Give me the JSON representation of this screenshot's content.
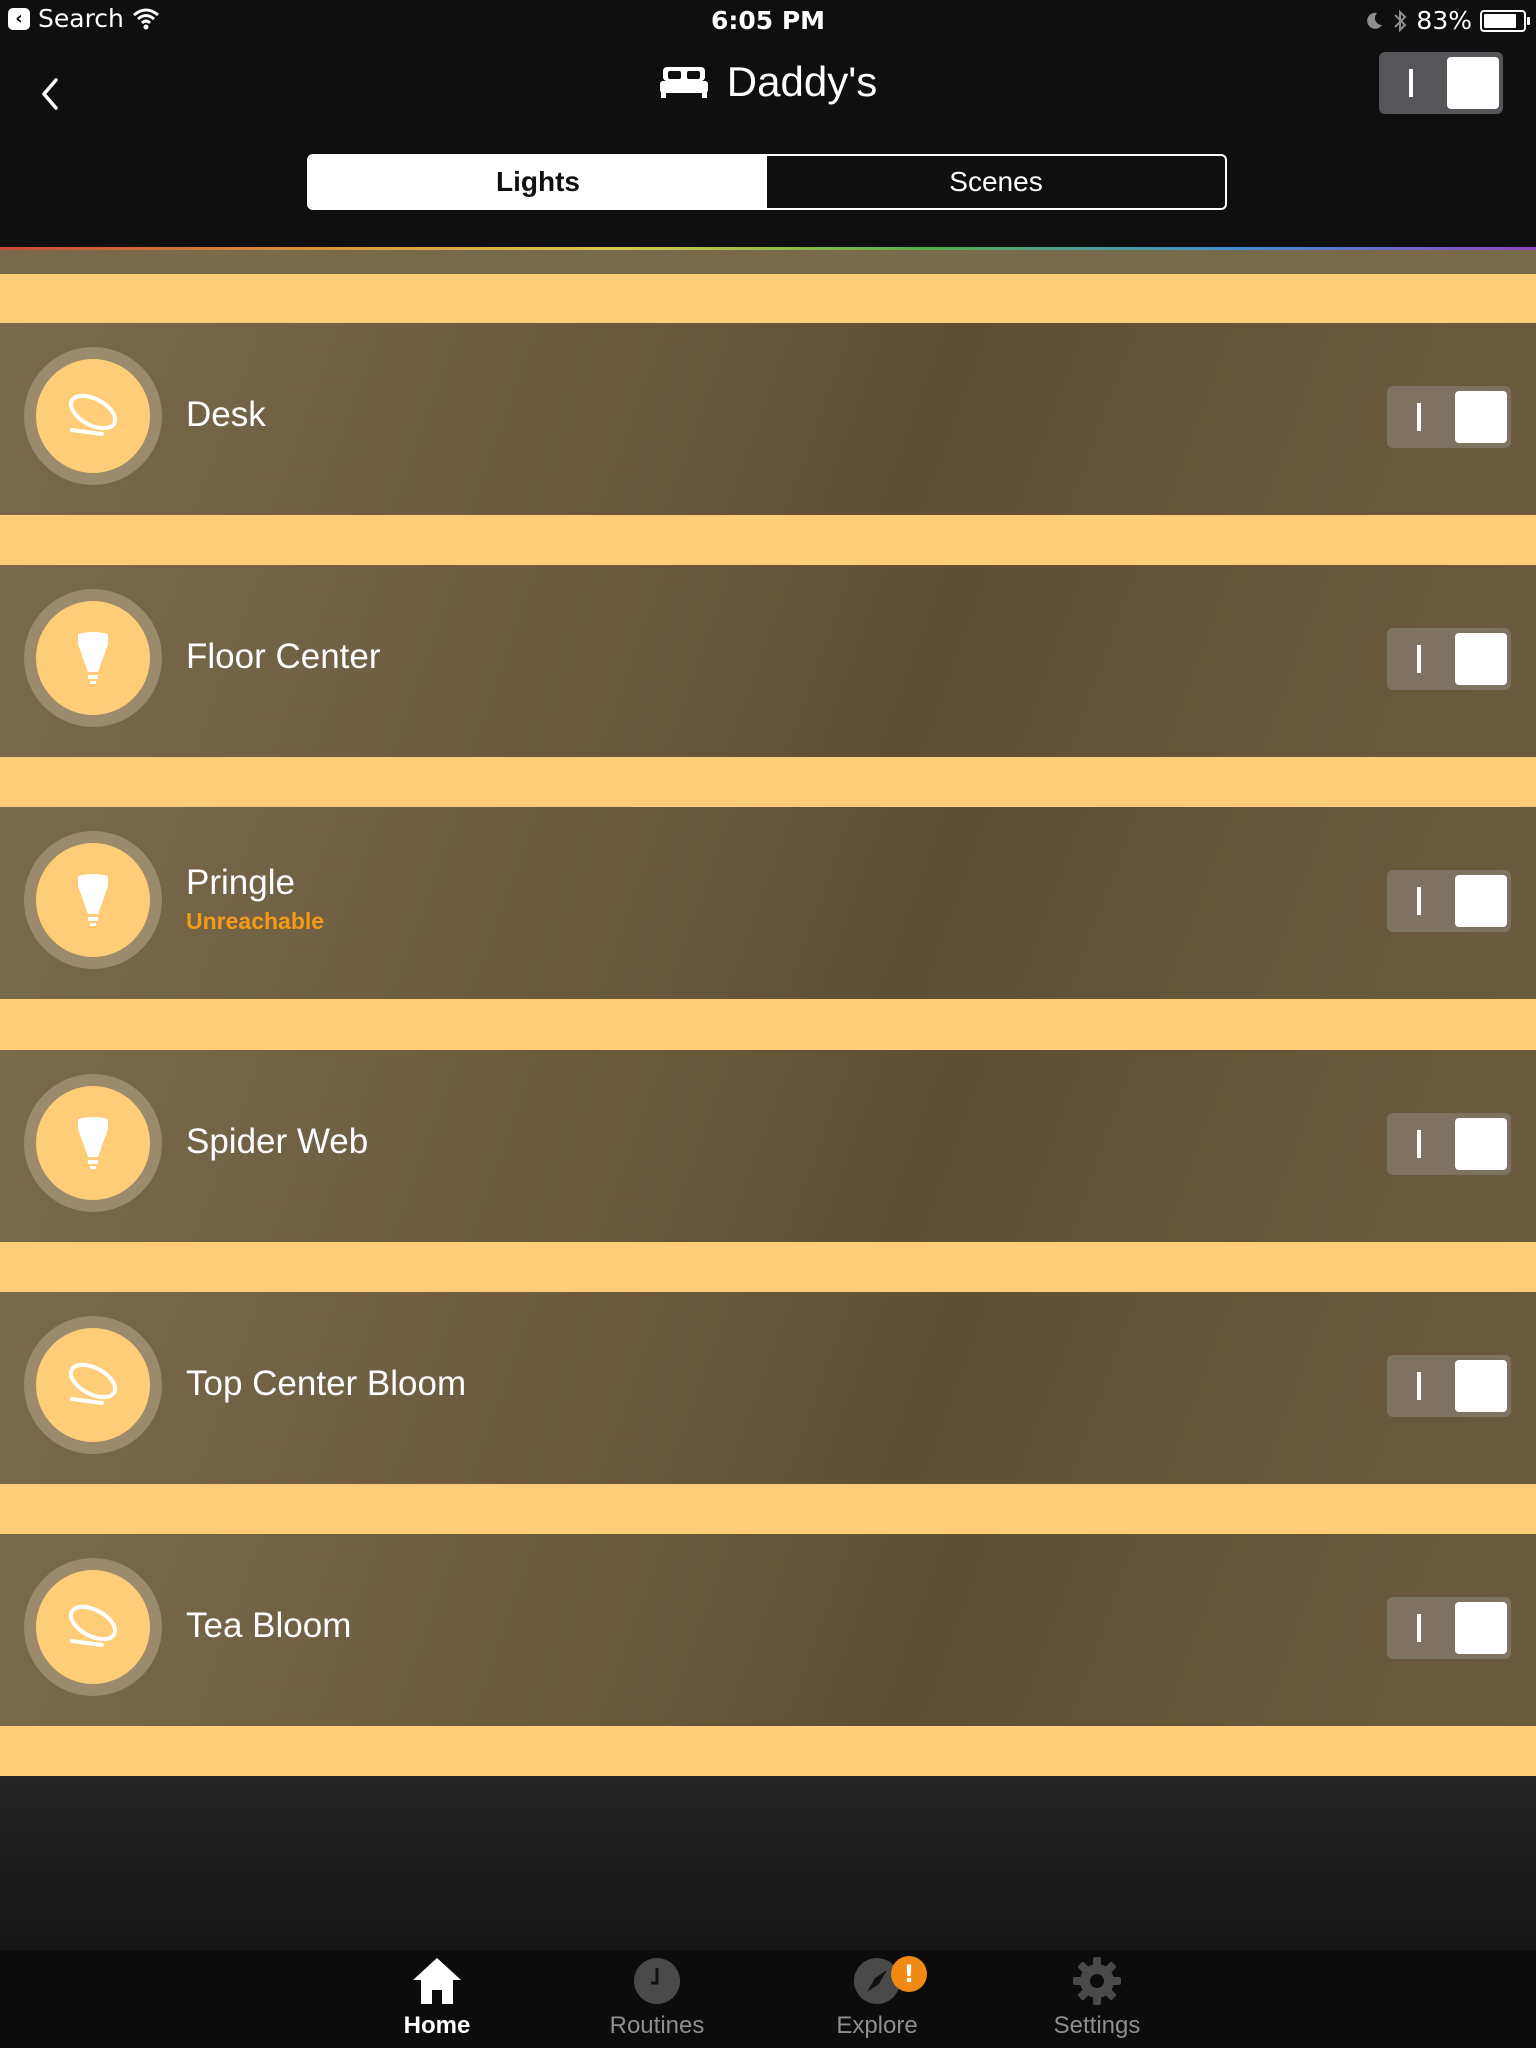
{
  "status_bar": {
    "back_app": "Search",
    "time": "6:05 PM",
    "battery": "83%",
    "battery_level": 0.83
  },
  "header": {
    "title": "Daddy's",
    "room_icon": "bed-icon",
    "room_power": "on"
  },
  "tabs": [
    {
      "label": "Lights",
      "active": true
    },
    {
      "label": "Scenes",
      "active": false
    }
  ],
  "lights": [
    {
      "name": "Desk",
      "status": "",
      "icon": "bloom-lamp-icon",
      "on": true
    },
    {
      "name": "Floor Center",
      "status": "",
      "icon": "bulb-icon",
      "on": true
    },
    {
      "name": "Pringle",
      "status": "Unreachable",
      "icon": "bulb-icon",
      "on": true
    },
    {
      "name": "Spider Web",
      "status": "",
      "icon": "bulb-icon",
      "on": true
    },
    {
      "name": "Top Center Bloom",
      "status": "",
      "icon": "bloom-lamp-icon",
      "on": true
    },
    {
      "name": "Tea Bloom",
      "status": "",
      "icon": "bloom-lamp-icon",
      "on": true
    }
  ],
  "tabbar": [
    {
      "label": "Home",
      "icon": "home-icon",
      "active": true
    },
    {
      "label": "Routines",
      "icon": "clock-icon",
      "active": false
    },
    {
      "label": "Explore",
      "icon": "compass-icon",
      "active": false,
      "badge": "!"
    },
    {
      "label": "Settings",
      "icon": "gear-icon",
      "active": false
    }
  ],
  "colors": {
    "accent": "#ffcd78",
    "warning": "#f39a16",
    "row": "#6b5b3e",
    "bar_bg": "#0f0f0f"
  }
}
